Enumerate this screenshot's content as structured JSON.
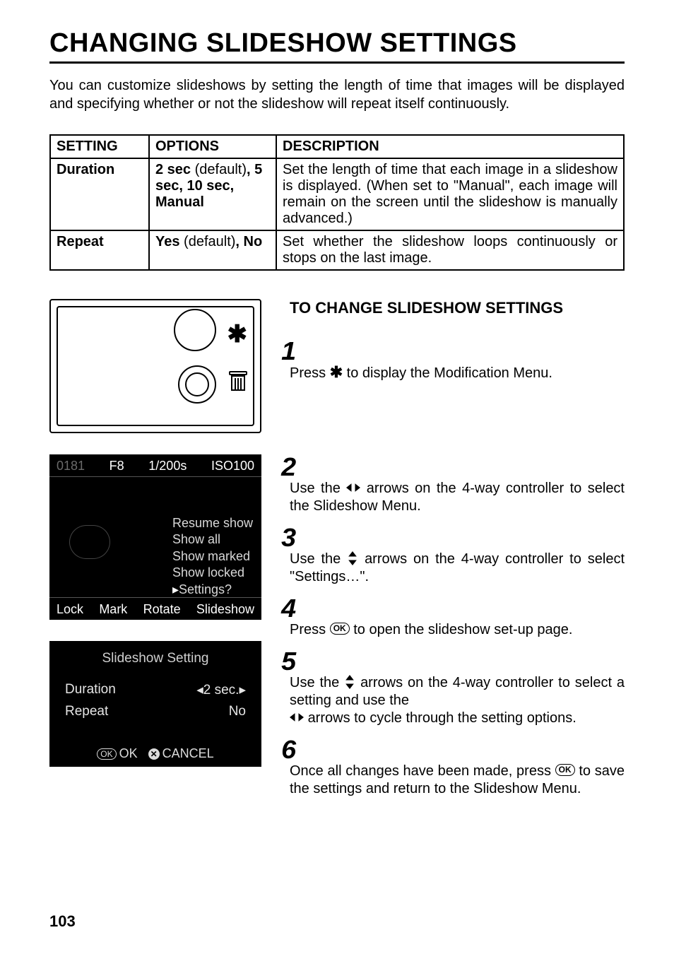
{
  "page": {
    "title": "CHANGING SLIDESHOW SETTINGS",
    "intro": "You can customize slideshows by setting the length of time that images will be displayed and specifying whether or not the slideshow will repeat itself continuously.",
    "page_number": "103"
  },
  "table": {
    "headers": {
      "c1": "SETTING",
      "c2": "OPTIONS",
      "c3": "DESCRIPTION"
    },
    "rows": [
      {
        "setting": "Duration",
        "options_html": "2 sec (default), 5 sec, 10 sec, Manual",
        "options_parts": {
          "p1": "2 sec",
          "p2": " (default)",
          "p3": ", ",
          "p4": "5 sec, 10 sec, Manual"
        },
        "description": "Set the length of time that each image in a slideshow is displayed.  (When set to \"Manual\", each image will remain on the screen until the slideshow is manually advanced.)"
      },
      {
        "setting": "Repeat",
        "options_parts": {
          "p1": "Yes",
          "p2": " (default)",
          "p3": ", ",
          "p4": "No"
        },
        "description": "Set whether the slideshow loops continuously or stops on the last image."
      }
    ]
  },
  "section": {
    "subhead": "TO CHANGE SLIDESHOW SETTINGS"
  },
  "steps": {
    "s1": {
      "num": "1",
      "pre": "Press ",
      "post": " to display the Modification Menu."
    },
    "s2": {
      "num": "2",
      "pre": "Use the ",
      "post": " arrows on the 4-way controller to select the Slideshow Menu."
    },
    "s3": {
      "num": "3",
      "pre": "Use the ",
      "post": " arrows on the 4-way controller to select \"Settings…\"."
    },
    "s4": {
      "num": "4",
      "pre": "Press ",
      "post": " to open the slideshow set-up page."
    },
    "s5": {
      "num": "5",
      "pre": "Use the ",
      "mid": " arrows on the 4-way controller  to select a setting and use the",
      "post": " arrows to cycle through the setting options."
    },
    "s6": {
      "num": "6",
      "pre": "Once all changes have been made, press ",
      "post": " to save the settings and return to the Slideshow Menu."
    }
  },
  "lcd1": {
    "top": {
      "a": "0181",
      "b": "F8",
      "c": "1/200s",
      "d": "ISO100"
    },
    "menu": [
      "Resume show",
      "Show all",
      "Show marked",
      "Show locked",
      "Settings?"
    ],
    "bottom": {
      "a": "Lock",
      "b": "Mark",
      "c": "Rotate",
      "d": "Slideshow"
    }
  },
  "lcd2": {
    "title": "Slideshow Setting",
    "rows": [
      {
        "label": "Duration",
        "value": "2 sec."
      },
      {
        "label": "Repeat",
        "value": "No"
      }
    ],
    "foot": {
      "ok_pill": "OK",
      "ok": "OK",
      "cancel": "CANCEL"
    }
  },
  "icons": {
    "star": "✱",
    "ok": "OK",
    "left_right": "lr",
    "up_down": "ud"
  }
}
